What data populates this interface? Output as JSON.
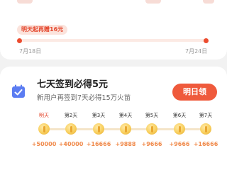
{
  "progress": {
    "tag_text": "明天起再赠16元",
    "start_date": "7月18日",
    "end_date": "7月24日"
  },
  "signin": {
    "title": "七天签到必得5元",
    "subtitle": "新用户再签到7天必得15万火苗",
    "button_label": "明日领",
    "days": [
      "明天",
      "第2天",
      "第3天",
      "第4天",
      "第5天",
      "第6天",
      "第7天"
    ],
    "rewards": [
      "+50000",
      "+40000",
      "+16666",
      "+9888",
      "+9666",
      "+9666",
      "+16666"
    ]
  },
  "colors": {
    "accent": "#ef5a3c",
    "reward": "#f08a4b",
    "coin": "#f8cf5d"
  }
}
